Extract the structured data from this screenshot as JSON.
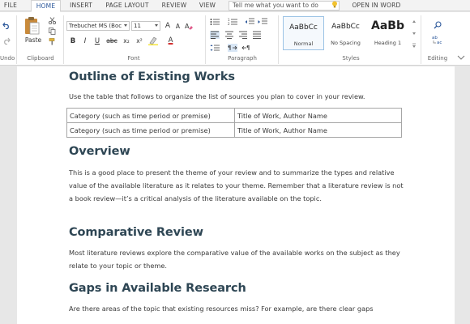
{
  "tabs": [
    "FILE",
    "HOME",
    "INSERT",
    "PAGE LAYOUT",
    "REVIEW",
    "VIEW"
  ],
  "active_tab": "HOME",
  "tell_me_placeholder": "Tell me what you want to do",
  "open_in_word": "OPEN IN WORD",
  "ribbon": {
    "undo_label": "Undo",
    "clipboard": {
      "paste_label": "Paste",
      "group_label": "Clipboard"
    },
    "font": {
      "font_name": "Trebuchet MS (Boc",
      "font_size": "11",
      "bold": "B",
      "italic": "I",
      "underline": "U",
      "strike": "abc",
      "subscript": "x₂",
      "superscript": "x²",
      "grow": "A",
      "shrink": "A",
      "font_color": "A",
      "group_label": "Font"
    },
    "paragraph": {
      "group_label": "Paragraph"
    },
    "styles": {
      "items": [
        {
          "preview": "AaBbCc",
          "name": "Normal"
        },
        {
          "preview": "AaBbCc",
          "name": "No Spacing"
        },
        {
          "preview": "AaBb",
          "name": "Heading 1"
        }
      ],
      "group_label": "Styles"
    },
    "editing": {
      "group_label": "Editing"
    }
  },
  "document": {
    "h1": "Outline of Existing Works",
    "p1": "Use the table that follows to organize the list of sources you plan to cover in your review.",
    "table": [
      [
        "Category (such as time period or premise)",
        "Title of Work, Author Name"
      ],
      [
        "Category (such as time period or premise)",
        "Title of Work, Author Name"
      ]
    ],
    "h2": "Overview",
    "p2": "This is a good place to present the theme of your review and to summarize the types and relative value of the available literature as it relates to your theme. Remember that a literature review is not a book review—it’s a critical analysis of the literature available on the topic.",
    "h3": "Comparative Review",
    "p3": "Most literature reviews explore the comparative value of the available works on the subject as they relate to your topic or theme.",
    "h4": "Gaps in Available Research",
    "p4": "Are there areas of the topic that existing resources miss? For example, are there clear gaps"
  },
  "colors": {
    "accent": "#2b579a",
    "heading": "#2e4654",
    "body_text": "#3a3a3a"
  }
}
